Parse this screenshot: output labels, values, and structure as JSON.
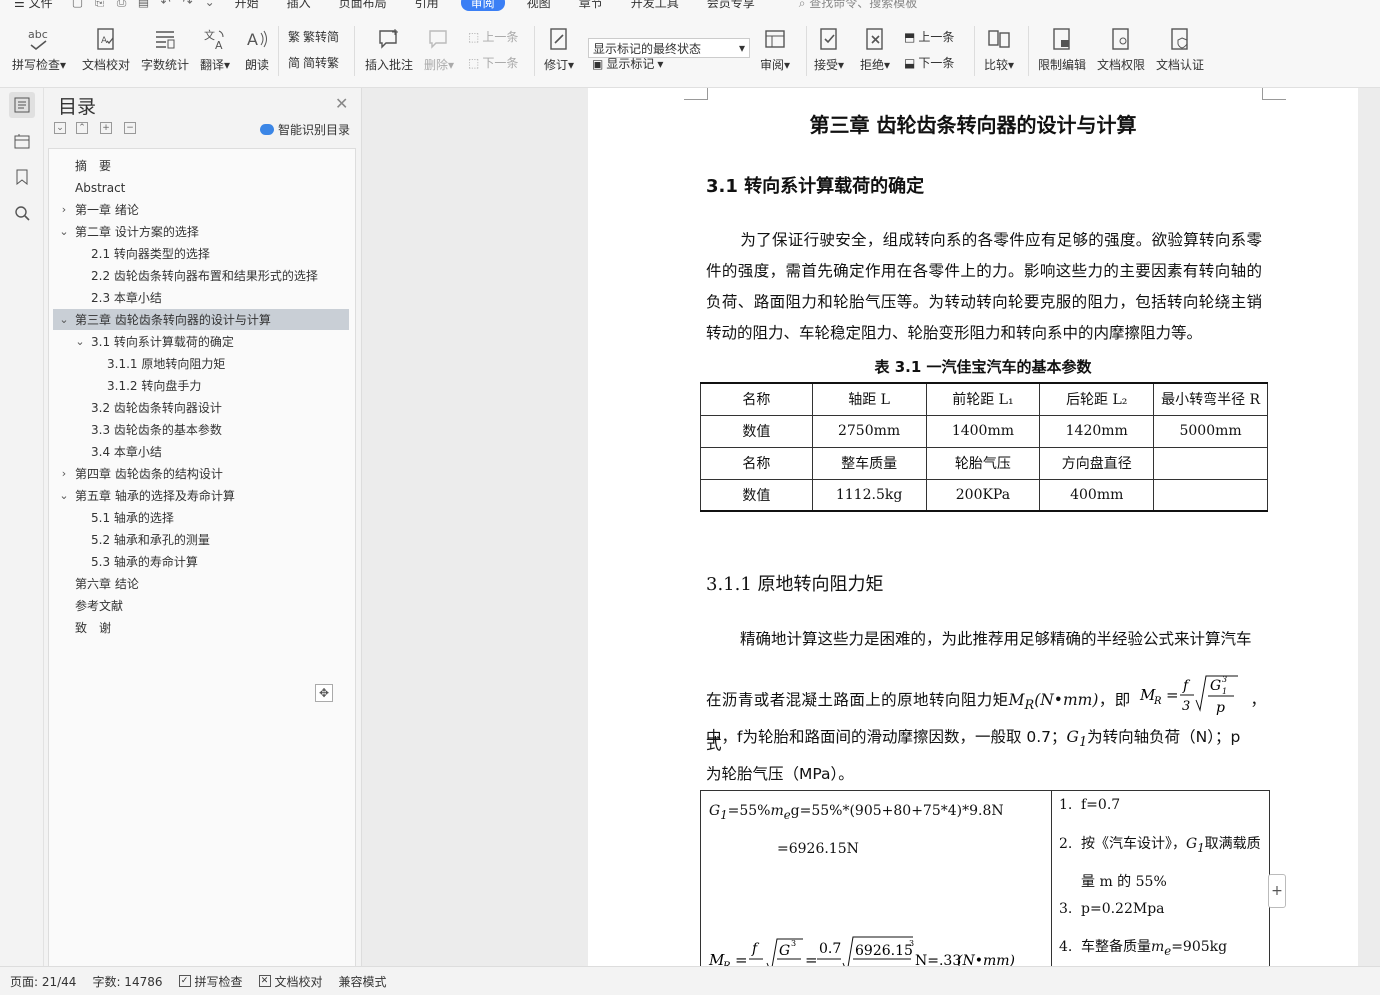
{
  "menu": {
    "file": "文件",
    "tabs": [
      "开始",
      "插入",
      "页面布局",
      "引用",
      "审阅",
      "视图",
      "章节",
      "开发工具",
      "会员专享"
    ],
    "active_tab": "审阅",
    "search_placeholder": "查找命令、搜索模板"
  },
  "ribbon": {
    "spell_check": "拼写检查",
    "doc_proof": "文档校对",
    "word_count": "字数统计",
    "translate": "翻译",
    "read_aloud": "朗读",
    "to_traditional": "繁转简",
    "to_simplified": "简转繁",
    "insert_comment": "插入批注",
    "delete": "删除",
    "prev_comment": "上一条",
    "next_comment": "下一条",
    "track_changes": "修订",
    "markup_state": "显示标记的最终状态",
    "show_markup": "显示标记",
    "review": "审阅",
    "accept": "接受",
    "reject": "拒绝",
    "prev_change": "上一条",
    "next_change": "下一条",
    "compare": "比较",
    "restrict_edit": "限制编辑",
    "doc_permission": "文档权限",
    "doc_cert": "文档认证"
  },
  "toc": {
    "title": "目录",
    "ai_label": "智能识别目录",
    "items": [
      {
        "label": "摘　要",
        "level": 0,
        "chev": ""
      },
      {
        "label": "Abstract",
        "level": 0,
        "chev": ""
      },
      {
        "label": "第一章  绪论",
        "level": 0,
        "chev": "right"
      },
      {
        "label": "第二章  设计方案的选择",
        "level": 0,
        "chev": "down"
      },
      {
        "label": "2.1  转向器类型的选择",
        "level": 1,
        "chev": ""
      },
      {
        "label": "2.2  齿轮齿条转向器布置和结果形式的选择",
        "level": 1,
        "chev": ""
      },
      {
        "label": "2.3 本章小结",
        "level": 1,
        "chev": ""
      },
      {
        "label": "第三章  齿轮齿条转向器的设计与计算",
        "level": 0,
        "chev": "down",
        "selected": true
      },
      {
        "label": "3.1 转向系计算载荷的确定",
        "level": 1,
        "chev": "down"
      },
      {
        "label": "3.1.1 原地转向阻力矩",
        "level": 2,
        "chev": ""
      },
      {
        "label": "3.1.2 转向盘手力",
        "level": 2,
        "chev": ""
      },
      {
        "label": "3.2 齿轮齿条转向器设计",
        "level": 1,
        "chev": ""
      },
      {
        "label": "3.3 齿轮齿条的基本参数",
        "level": 1,
        "chev": ""
      },
      {
        "label": "3.4 本章小结",
        "level": 1,
        "chev": ""
      },
      {
        "label": "第四章  齿轮齿条的结构设计",
        "level": 0,
        "chev": "right"
      },
      {
        "label": "第五章  轴承的选择及寿命计算",
        "level": 0,
        "chev": "down"
      },
      {
        "label": "5.1 轴承的选择",
        "level": 1,
        "chev": ""
      },
      {
        "label": "5.2 轴承和承孔的测量",
        "level": 1,
        "chev": ""
      },
      {
        "label": "5.3 轴承的寿命计算",
        "level": 1,
        "chev": ""
      },
      {
        "label": "第六章  结论",
        "level": 0,
        "chev": ""
      },
      {
        "label": "参考文献",
        "level": 0,
        "chev": ""
      },
      {
        "label": "致　谢",
        "level": 0,
        "chev": ""
      }
    ]
  },
  "doc": {
    "chapter_title": "第三章  齿轮齿条转向器的设计与计算",
    "h_31": "3.1 转向系计算载荷的确定",
    "para1": "为了保证行驶安全，组成转向系的各零件应有足够的强度。欲验算转向系零件的强度，需首先确定作用在各零件上的力。影响这些力的主要因素有转向轴的负荷、路面阻力和轮胎气压等。为转动转向轮要克服的阻力，包括转向轮绕主销转动的阻力、车轮稳定阻力、轮胎变形阻力和转向系中的内摩擦阻力等。",
    "table_caption": "表 3.1 一汽佳宝汽车的基本参数",
    "table": {
      "rows": [
        [
          "名称",
          "轴距 L",
          "前轮距 L₁",
          "后轮距 L₂",
          "最小转弯半径 R"
        ],
        [
          "数值",
          "2750mm",
          "1400mm",
          "1420mm",
          "5000mm"
        ],
        [
          "名称",
          "整车质量",
          "轮胎气压",
          "方向盘直径",
          ""
        ],
        [
          "数值",
          "1112.5kg",
          "200KPa",
          "400mm",
          ""
        ]
      ]
    },
    "h_311": "3.1.1 原地转向阻力矩",
    "para2_a": "精确地计算这些力是困难的，为此推荐用足够精确的半经验公式来计算汽车",
    "para2_b": "在沥青或者混凝土路面上的原地转向阻力矩",
    "para2_mr": "M",
    "para2_mr_sub": "R",
    "para2_unit": "(N•mm)",
    "para2_c": "，即",
    "para2_d": "，式",
    "para3": "中，f为轮胎和路面间的滑动摩擦因数，一般取 0.7；",
    "para3_g": "G",
    "para3_g_sub": "1",
    "para3_b": "为转向轴负荷（N）；p",
    "para4": "为轮胎气压（MPa）。",
    "calc1": "=55%",
    "calc1_me": "m",
    "calc1_me_sub": "e",
    "calc1_rest": "g=55%*(905+80+75*4)*9.8N",
    "calc2": "=6926.15N",
    "calc3_num1": "0.7",
    "calc3_num2": "6926.15",
    "calc3_tail": "N=.33",
    "calc3_unit": "(N•mm)",
    "notes": [
      {
        "n": "1.",
        "text": "f=0.7"
      },
      {
        "n": "2.",
        "text": "按《汽车设计》，",
        "text2": "取满载质"
      },
      {
        "n": "",
        "text": "量 m 的 55%"
      },
      {
        "n": "3.",
        "text": "p=0.22Mpa"
      },
      {
        "n": "4.",
        "text": "车整备质量",
        "text2": "=905kg"
      }
    ]
  },
  "status": {
    "page": "页面: 21/44",
    "words": "字数: 14786",
    "spell": "拼写检查",
    "proof": "文档校对",
    "compat": "兼容模式"
  }
}
